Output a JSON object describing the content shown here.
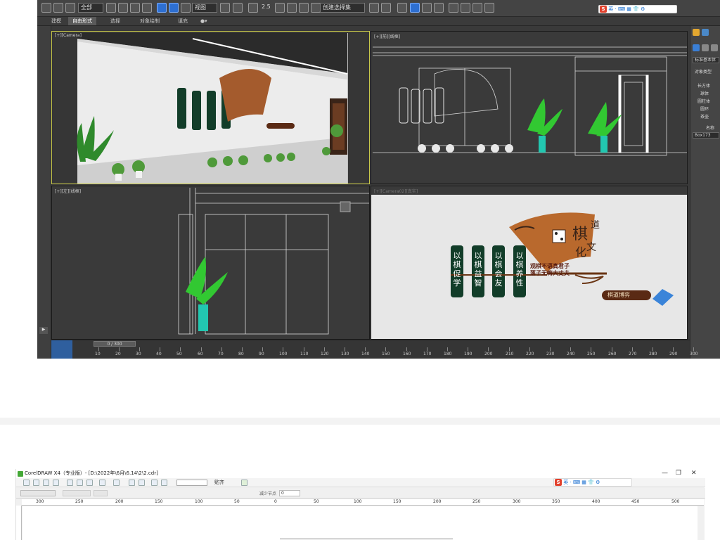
{
  "max": {
    "toolbar": {
      "selection_filter": "全部",
      "ref_coord": "视图",
      "named_selection": "创建选择集",
      "snap_value": "2.5"
    },
    "ribbon_tabs": [
      "建模",
      "自由形式",
      "选择",
      "对象绘制",
      "填充"
    ],
    "viewports": {
      "top_left_label": "[+][Camera]",
      "top_right_label": "[+][前][线框]",
      "bottom_left_label": "[+][左][线框]",
      "bottom_right_label": "[+][Camera02][真实]"
    },
    "sign": {
      "banners": [
        "以棋促学",
        "以棋益智",
        "以棋会友",
        "以棋养性"
      ],
      "title_main": "棋",
      "title_dao": "道",
      "title_hua": "化",
      "title_wen": "文",
      "slogan_line1": "观棋不语真君子",
      "slogan_line2": "落子无悔大丈夫",
      "plaque": "棋道博弈"
    },
    "command_panel": {
      "category": "标准基本体",
      "section_object_type": "对象类型",
      "primitives": [
        "长方体",
        "球体",
        "圆柱体",
        "圆环",
        "茶壶"
      ],
      "section_name": "名称",
      "object_name": "Box173"
    },
    "timeline": {
      "slider": "0 / 300",
      "ticks": [
        "10",
        "20",
        "30",
        "40",
        "50",
        "60",
        "70",
        "80",
        "90",
        "100",
        "110",
        "120",
        "130",
        "140",
        "150",
        "160",
        "170",
        "180",
        "190",
        "200",
        "210",
        "220",
        "230",
        "240",
        "250",
        "260",
        "270",
        "280",
        "290",
        "300"
      ]
    },
    "ime_labels": [
      "S",
      "英",
      "·",
      "⌨",
      "▦",
      "👕",
      "⚙"
    ]
  },
  "corel": {
    "title": "CorelDRAW X4（专业版）- [D:\\2022年\\6月\\6.14\\2\\2.cdr]",
    "window_buttons": [
      "—",
      "❐",
      "✕"
    ],
    "paste_label": "贴齐",
    "prop_label": "减少节点",
    "prop_value": "0",
    "top_ruler": [
      "300",
      "250",
      "200",
      "150",
      "100",
      "50",
      "0",
      "50",
      "100",
      "150",
      "200",
      "250",
      "300",
      "350",
      "400",
      "450",
      "500"
    ]
  }
}
